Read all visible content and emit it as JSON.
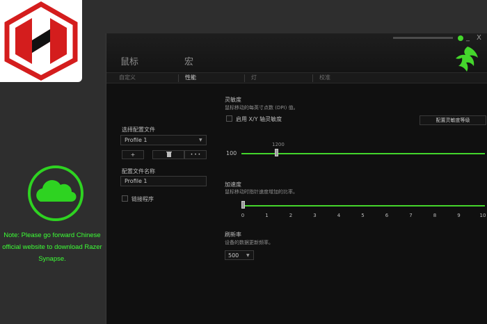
{
  "note": {
    "line1": "Note: Please go forward Chinese",
    "line2": "official website to download Razer",
    "line3": "Synapse."
  },
  "window": {
    "minimize": "_",
    "close": "X"
  },
  "main_tabs": [
    "鼠标",
    "宏"
  ],
  "sub_tabs": [
    "自定义",
    "性能",
    "灯",
    "校准"
  ],
  "active_sub_tab": "性能",
  "profile": {
    "select_label": "选择配置文件",
    "selected": "Profile 1",
    "add_label": "+",
    "delete_icon": "trash-icon",
    "more_label": "• • •",
    "name_label": "配置文件名称",
    "name_value": "Profile 1",
    "link_program_label": "链接程序"
  },
  "sensitivity": {
    "title": "灵敏度",
    "subtitle": "鼠标移动的每英寸点数 (DPI) 值。",
    "xy_checkbox_label": "启用 X/Y 轴灵敏度",
    "config_button": "配置灵敏度等级",
    "min_label": "100",
    "value_label": "1200",
    "dpi_min": 100,
    "dpi_max": 16000,
    "dpi_value": 1200
  },
  "acceleration": {
    "title": "加速度",
    "subtitle": "鼠标移动时指针速度增加的比率。",
    "ticks": [
      "0",
      "1",
      "2",
      "3",
      "4",
      "5",
      "6",
      "7",
      "8",
      "9",
      "10"
    ],
    "value": 0
  },
  "polling": {
    "title": "刷新率",
    "subtitle": "设备的数据更新频率。",
    "value": "500"
  },
  "colors": {
    "accent": "#44d62c",
    "note_text": "#3dff36",
    "cloud": "#2ed321"
  }
}
